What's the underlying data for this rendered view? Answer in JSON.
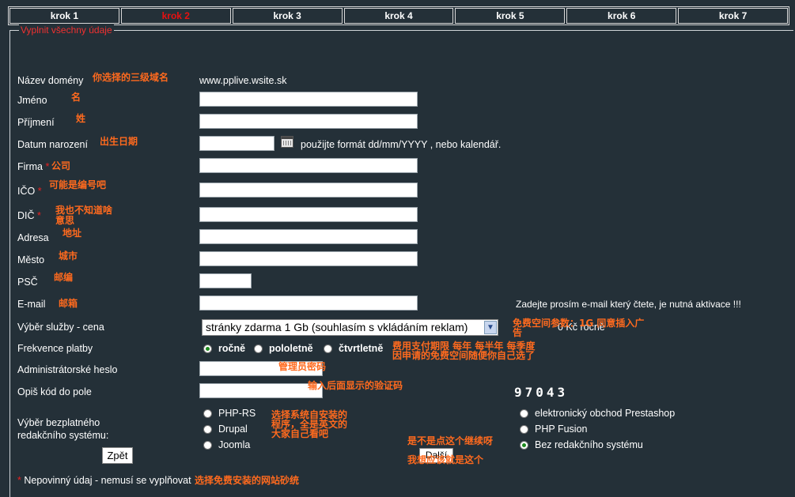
{
  "steps": [
    "krok 1",
    "krok 2",
    "krok 3",
    "krok 4",
    "krok 5",
    "krok 6",
    "krok 7"
  ],
  "active_step": "krok 2",
  "legend": "Vyplnit všechny údaje",
  "fields": {
    "domain": {
      "label": "Název domény",
      "value": "www.pplive.wsite.sk",
      "note": "你选择的三级域名"
    },
    "first_name": {
      "label": "Jméno",
      "note": "名"
    },
    "last_name": {
      "label": "Příjmení",
      "note": "姓"
    },
    "birthdate": {
      "label": "Datum narození",
      "note": "出生日期",
      "hint": "použijte formát dd/mm/YYYY , nebo kalendář."
    },
    "company": {
      "label": "Firma",
      "note": "公司"
    },
    "ico": {
      "label": "IČO",
      "note": "可能是编号吧"
    },
    "dic": {
      "label": "DIČ",
      "note_line1": "我也不知道啥",
      "note_line2": "意思"
    },
    "address": {
      "label": "Adresa",
      "note": "地址"
    },
    "city": {
      "label": "Město",
      "note": "城市"
    },
    "zip": {
      "label": "PSČ",
      "note": "邮编"
    },
    "email": {
      "label": "E-mail",
      "note": "邮箱",
      "hint": "Zadejte prosím e-mail který čtete, je nutná aktivace !!!"
    },
    "service": {
      "label": "Výběr služby - cena",
      "selected": "stránky zdarma 1 Gb (souhlasím s vkládáním reklam)",
      "price": "0 Kč ročně",
      "note_line1": "免费空间参数：1G 同意插入广",
      "note_line2": "告"
    },
    "frequency": {
      "label": "Frekvence platby",
      "options": [
        "ročně",
        "pololetně",
        "čtvrtletně"
      ],
      "selected": "ročně",
      "note_line1": "费用支付期限  每年  每半年  每季度",
      "note_line2": "因申请的免费空间随便你自己选了"
    },
    "admin_password": {
      "label": "Administrátorské heslo",
      "note": "管理员密码"
    },
    "captcha": {
      "label": "Opiš kód do pole",
      "note": "输入后面显示的验证码",
      "code": "97043"
    },
    "cms": {
      "label_line1": "Výběr bezplatného",
      "label_line2": "redakčního systému:",
      "options_left": [
        "PHP-RS",
        "Drupal",
        "Joomla"
      ],
      "options_right": [
        "elektronický obchod Prestashop",
        "PHP Fusion",
        "Bez redakčního systému"
      ],
      "selected": "Bez redakčního systému",
      "note_line1": "选择系统自安装的",
      "note_line2": "程序，全是英文的",
      "note_line3": "大家自己看吧"
    }
  },
  "buttons": {
    "back": "Zpět",
    "next": "Další"
  },
  "next_note_line1": "是不是点这个继续呀",
  "next_note_line2": "我想应该就是这个",
  "footer": {
    "asterisk": "*",
    "text": "Nepovinný údaj - nemusí se vyplňovat",
    "note": "选择免费安装的网站砂统"
  },
  "colors": {
    "background": "#243038",
    "accent_red": "#e81010",
    "note_orange": "#ff6a1e"
  }
}
